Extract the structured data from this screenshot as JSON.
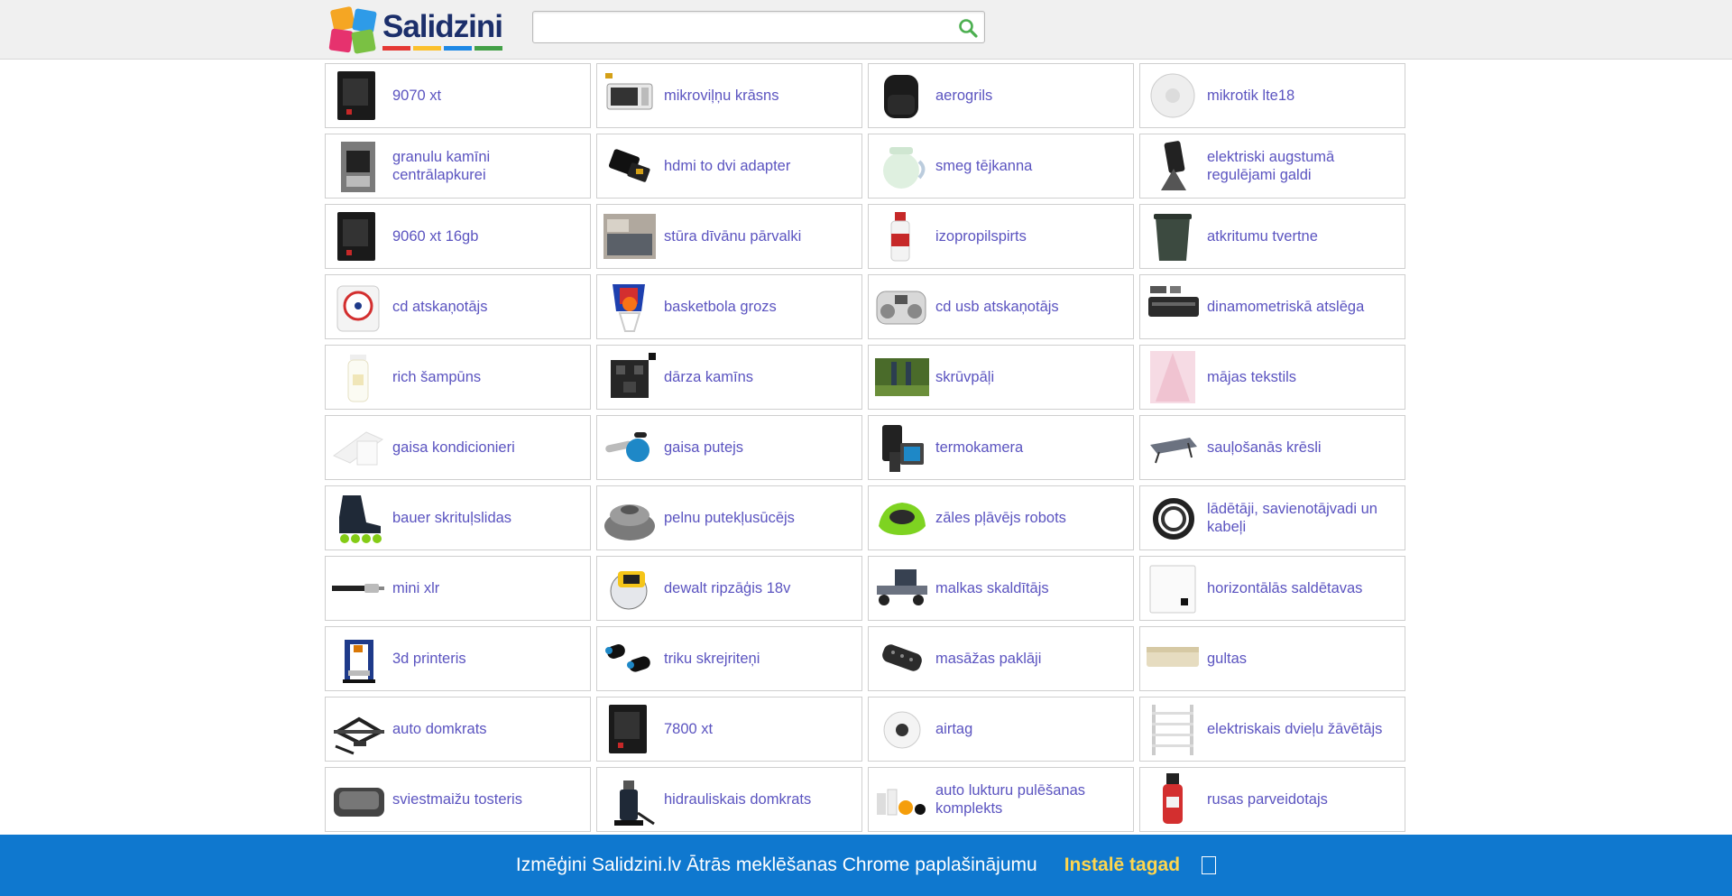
{
  "header": {
    "logo_text": "Salidzini",
    "search": {
      "value": "",
      "placeholder": ""
    },
    "search_icon": "magnifier-icon"
  },
  "colors": {
    "link": "#5b54c0",
    "banner_bg": "#0f78cf",
    "banner_cta": "#ffd64d",
    "logo_squares": [
      "#f5a623",
      "#2e9be8",
      "#e6326e",
      "#7ac143"
    ],
    "logo_stripes": [
      "#e53935",
      "#fbc02d",
      "#1e88e5",
      "#43a047"
    ]
  },
  "products": [
    {
      "label": "9070 xt",
      "icon": "gpu-box-icon"
    },
    {
      "label": "mikroviļņu krāsns",
      "icon": "microwave-icon"
    },
    {
      "label": "aerogrils",
      "icon": "air-fryer-icon"
    },
    {
      "label": "mikrotik lte18",
      "icon": "antenna-disc-icon"
    },
    {
      "label": "granulu kamīni centrālapkurei",
      "icon": "pellet-stove-icon"
    },
    {
      "label": "hdmi to dvi adapter",
      "icon": "adapter-icon"
    },
    {
      "label": "smeg tējkanna",
      "icon": "kettle-icon"
    },
    {
      "label": "elektriski augstumā regulējami galdi",
      "icon": "phone-stand-icon"
    },
    {
      "label": "9060 xt 16gb",
      "icon": "gpu-box-icon"
    },
    {
      "label": "stūra dīvānu pārvalki",
      "icon": "sofa-cover-icon"
    },
    {
      "label": "izopropilspirts",
      "icon": "bottle-icon"
    },
    {
      "label": "atkritumu tvertne",
      "icon": "trash-bin-icon"
    },
    {
      "label": "cd atskaņotājs",
      "icon": "cd-player-icon"
    },
    {
      "label": "basketbola grozs",
      "icon": "basketball-hoop-icon"
    },
    {
      "label": "cd usb atskaņotājs",
      "icon": "boombox-icon"
    },
    {
      "label": "dinamometriskā atslēga",
      "icon": "torque-wrench-case-icon"
    },
    {
      "label": "rich šampūns",
      "icon": "shampoo-icon"
    },
    {
      "label": "dārza kamīns",
      "icon": "fire-pit-icon"
    },
    {
      "label": "skrūvpāļi",
      "icon": "ground-screw-icon"
    },
    {
      "label": "mājas tekstils",
      "icon": "canopy-icon"
    },
    {
      "label": "gaisa kondicionieri",
      "icon": "air-conditioner-icon"
    },
    {
      "label": "gaisa putejs",
      "icon": "leaf-blower-icon"
    },
    {
      "label": "termokamera",
      "icon": "thermal-camera-icon"
    },
    {
      "label": "sauļošanās krēsli",
      "icon": "lounger-icon"
    },
    {
      "label": "bauer skrituļslidas",
      "icon": "inline-skate-icon"
    },
    {
      "label": "pelnu putekļusūcējs",
      "icon": "ash-vacuum-icon"
    },
    {
      "label": "zāles pļāvējs robots",
      "icon": "robot-mower-icon"
    },
    {
      "label": "lādētāji, savienotājvadi un kabeļi",
      "icon": "cable-icon"
    },
    {
      "label": "mini xlr",
      "icon": "xlr-cable-icon"
    },
    {
      "label": "dewalt ripzāģis 18v",
      "icon": "circular-saw-icon"
    },
    {
      "label": "malkas skaldītājs",
      "icon": "log-splitter-icon"
    },
    {
      "label": "horizontālās saldētavas",
      "icon": "chest-freezer-icon"
    },
    {
      "label": "3d printeris",
      "icon": "3d-printer-icon"
    },
    {
      "label": "triku skrejriteņi",
      "icon": "scooter-grips-icon"
    },
    {
      "label": "masāžas paklāji",
      "icon": "massage-roller-icon"
    },
    {
      "label": "gultas",
      "icon": "bed-icon"
    },
    {
      "label": "auto domkrats",
      "icon": "scissor-jack-icon"
    },
    {
      "label": "7800 xt",
      "icon": "gpu-box-icon"
    },
    {
      "label": "airtag",
      "icon": "airtag-icon"
    },
    {
      "label": "elektriskais dvieļu žāvētājs",
      "icon": "towel-rail-icon"
    },
    {
      "label": "sviestmaižu tosteris",
      "icon": "sandwich-toaster-icon"
    },
    {
      "label": "hidrauliskais domkrats",
      "icon": "bottle-jack-icon"
    },
    {
      "label": "auto lukturu pulēšanas komplekts",
      "icon": "polish-kit-icon"
    },
    {
      "label": "rusas parveidotajs",
      "icon": "spray-bottle-icon"
    }
  ],
  "banner": {
    "text": "Izmēģini Salidzini.lv Ātrās meklēšanas Chrome paplašinājumu",
    "cta": "Instalē tagad",
    "close_icon": "close-icon"
  }
}
